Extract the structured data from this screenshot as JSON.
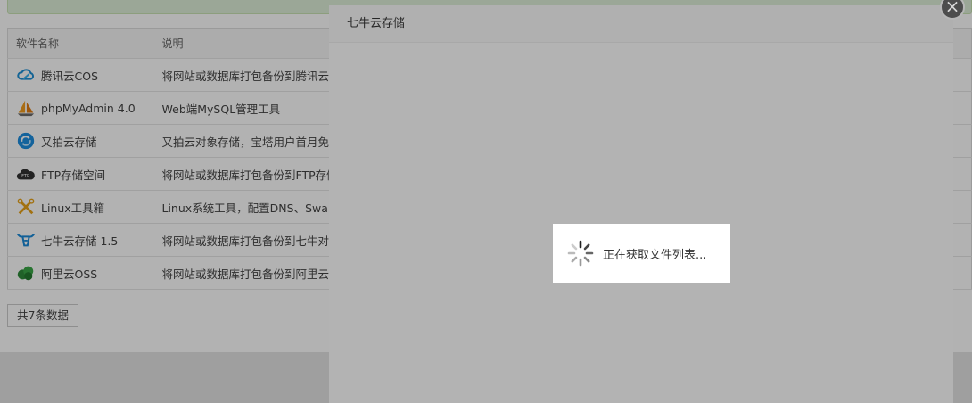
{
  "table": {
    "headers": [
      "软件名称",
      "说明"
    ],
    "rows": [
      {
        "name": "腾讯云COS",
        "desc": "将网站或数据库打包备份到腾讯云C",
        "icon": "tencent-cloud-icon"
      },
      {
        "name": "phpMyAdmin 4.0",
        "desc": "Web端MySQL管理工具",
        "icon": "phpmyadmin-sailboat-icon"
      },
      {
        "name": "又拍云存储",
        "desc": "又拍云对象存储，宝塔用户首月免费",
        "icon": "upyun-icon"
      },
      {
        "name": "FTP存储空间",
        "desc": "将网站或数据库打包备份到FTP存储",
        "icon": "ftp-cloud-icon"
      },
      {
        "name": "Linux工具箱",
        "desc": "Linux系统工具，配置DNS、Swap、",
        "icon": "tools-icon"
      },
      {
        "name": "七牛云存储 1.5",
        "desc": "将网站或数据库打包备份到七牛对象",
        "icon": "qiniu-cow-icon"
      },
      {
        "name": "阿里云OSS",
        "desc": "将网站或数据库打包备份到阿里云C",
        "icon": "aliyun-oss-icon"
      }
    ]
  },
  "pager": {
    "total_label": "共7条数据"
  },
  "dialog": {
    "title": "七牛云存储",
    "close_label": "×"
  },
  "loading": {
    "text": "正在获取文件列表..."
  }
}
